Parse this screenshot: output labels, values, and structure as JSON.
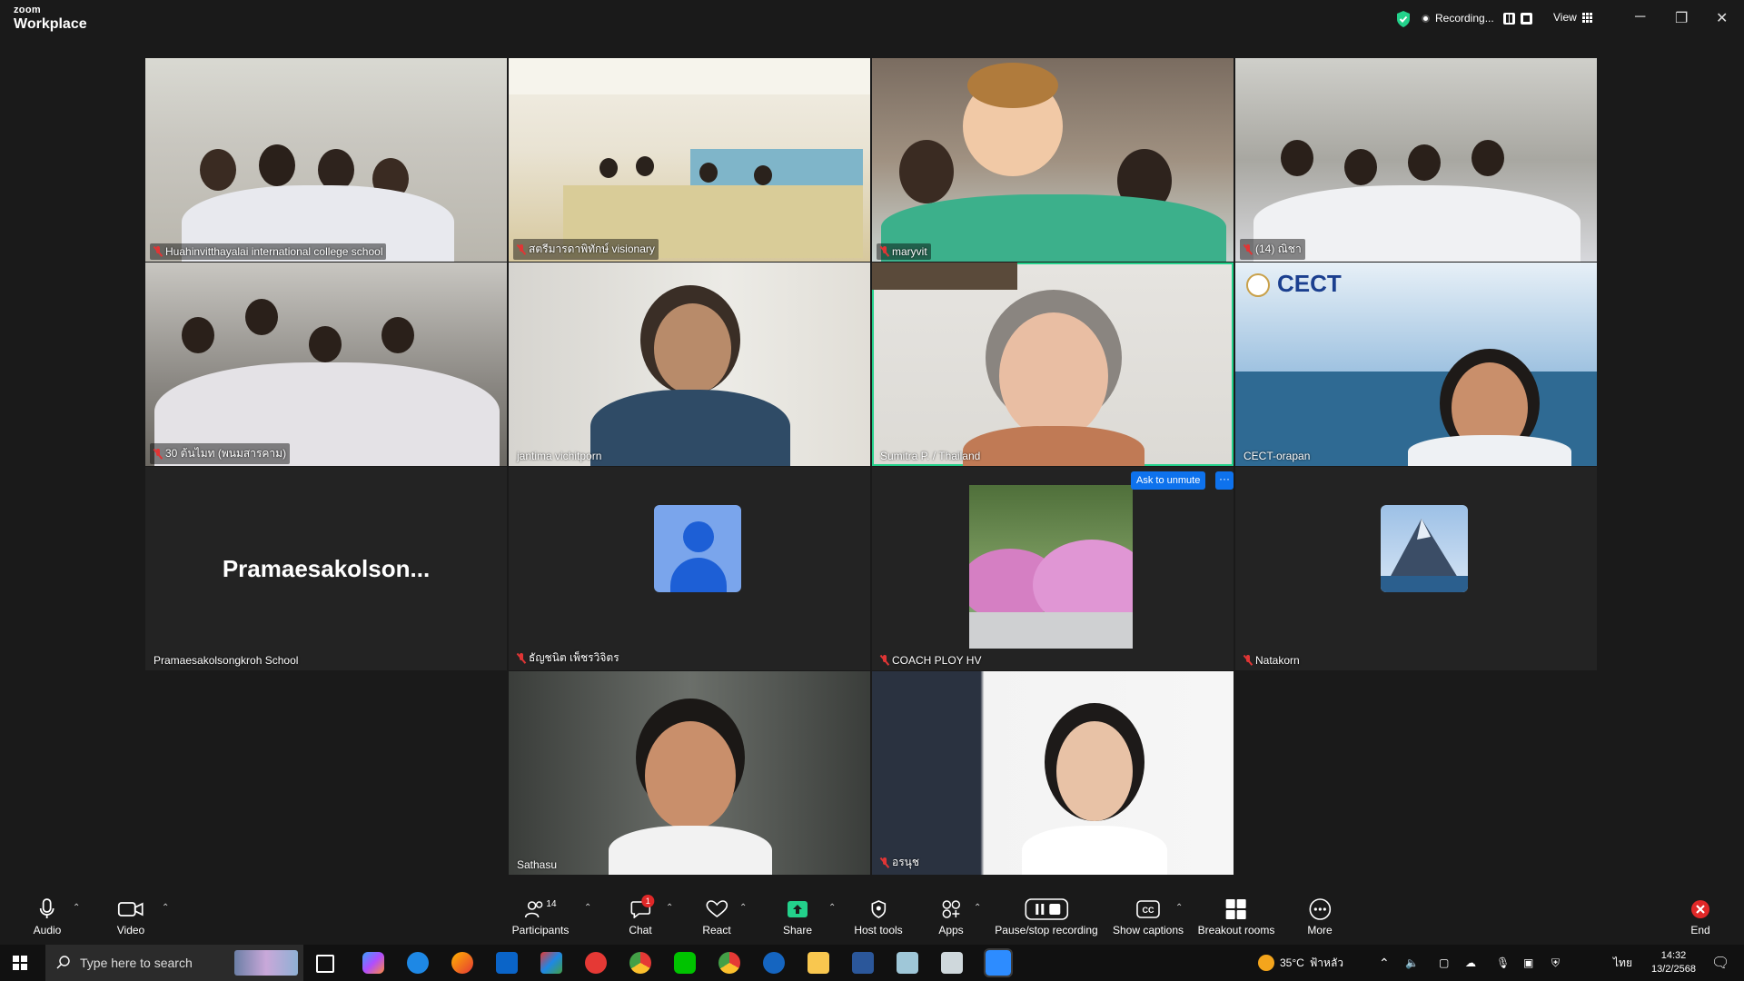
{
  "app": {
    "brand_small": "zoom",
    "brand_big": "Workplace"
  },
  "topbar": {
    "recording_label": "Recording...",
    "view_label": "View"
  },
  "tiles": [
    {
      "name": "Huahinvitthayalai international college school",
      "muted": true
    },
    {
      "name": "สตรีมารดาพิทักษ์ visionary",
      "muted": true
    },
    {
      "name": "maryvit",
      "muted": true
    },
    {
      "name": "(14) ณิชา",
      "muted": true
    },
    {
      "name": "30 ต้นไมท (พนมสารคาม)",
      "muted": true
    },
    {
      "name": "jantima vichitporn",
      "muted": false
    },
    {
      "name": "Sumitra P. / Thailand",
      "muted": false
    },
    {
      "name": "CECT-orapan",
      "muted": false
    },
    {
      "name": "Pramaesakolsongkroh School",
      "muted": false,
      "placeholder": "Pramaesakolson..."
    },
    {
      "name": "ธัญชนิต เพ็ชรวิจิตร",
      "muted": true
    },
    {
      "name": "COACH PLOY HV",
      "muted": true
    },
    {
      "name": "Natakorn",
      "muted": true
    },
    {
      "name": "Sathasu",
      "muted": false
    },
    {
      "name": "อรนุช",
      "muted": true
    }
  ],
  "cect_logo_text": "CECT",
  "ask_to_unmute": "Ask to unmute",
  "more_dots": "···",
  "toolbar": {
    "audio": "Audio",
    "video": "Video",
    "participants": "Participants",
    "participants_count": "14",
    "chat": "Chat",
    "chat_badge": "1",
    "react": "React",
    "share": "Share",
    "host_tools": "Host tools",
    "apps": "Apps",
    "pause_stop_recording": "Pause/stop recording",
    "show_captions": "Show captions",
    "breakout_rooms": "Breakout rooms",
    "more": "More",
    "end": "End"
  },
  "taskbar": {
    "search_placeholder": "Type here to search",
    "weather": "35°C",
    "weather_desc": "ฟ้าหลัว",
    "lang": "ไทย",
    "time": "14:32",
    "date": "13/2/2568"
  },
  "colors": {
    "accent": "#0e72ed",
    "active_speaker": "#23d18b",
    "mute_red": "#e03535",
    "share_green": "#23d18b"
  }
}
